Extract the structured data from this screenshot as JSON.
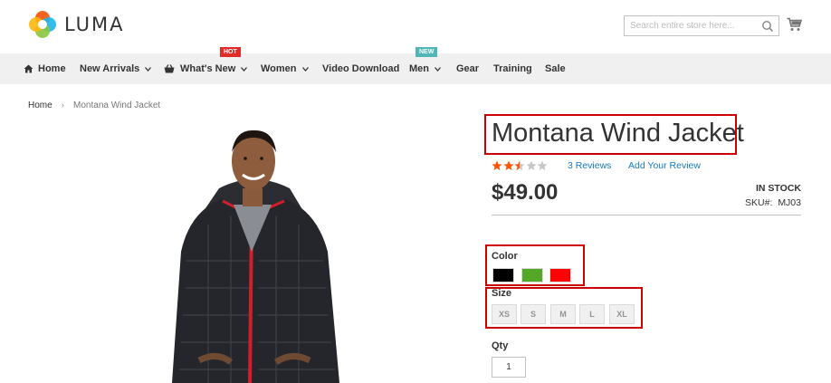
{
  "brand": {
    "name": "LUMA"
  },
  "search": {
    "placeholder": "Search entire store here..."
  },
  "nav": {
    "items": [
      {
        "label": "Home",
        "has_icon": "home-icon",
        "has_chevron": false
      },
      {
        "label": "New Arrivals",
        "has_chevron": true
      },
      {
        "label": "What's New",
        "has_icon": "basket-icon",
        "has_chevron": true,
        "badge": "HOT"
      },
      {
        "label": "Women",
        "has_chevron": true
      },
      {
        "label": "Video Download",
        "has_chevron": false
      },
      {
        "label": "Men",
        "has_chevron": true,
        "badge": "NEW"
      },
      {
        "label": "Gear",
        "has_chevron": false
      },
      {
        "label": "Training",
        "has_chevron": false
      },
      {
        "label": "Sale",
        "has_chevron": false
      }
    ]
  },
  "breadcrumb": {
    "home": "Home",
    "separator": "›",
    "current": "Montana Wind Jacket"
  },
  "product": {
    "title": "Montana Wind Jacket",
    "rating": {
      "stars_filled": 2.5,
      "stars_total": 5
    },
    "reviews_link": "3 Reviews",
    "add_review_link": "Add Your Review",
    "price": "$49.00",
    "stock": "IN STOCK",
    "sku_label": "SKU#:",
    "sku": "MJ03",
    "color_label": "Color",
    "colors": [
      {
        "name": "black",
        "hex": "#000000"
      },
      {
        "name": "green",
        "hex": "#53a828"
      },
      {
        "name": "red",
        "hex": "#ff0000"
      }
    ],
    "size_label": "Size",
    "sizes": [
      "XS",
      "S",
      "M",
      "L",
      "XL"
    ],
    "qty_label": "Qty",
    "qty_value": "1"
  },
  "colors": {
    "accent_link": "#1979c3",
    "highlight_border": "#cc0000",
    "star_filled": "#ff5501",
    "star_empty": "#c7c7c7",
    "badge_hot": "#e02b27",
    "badge_new": "#4fb6b7"
  }
}
